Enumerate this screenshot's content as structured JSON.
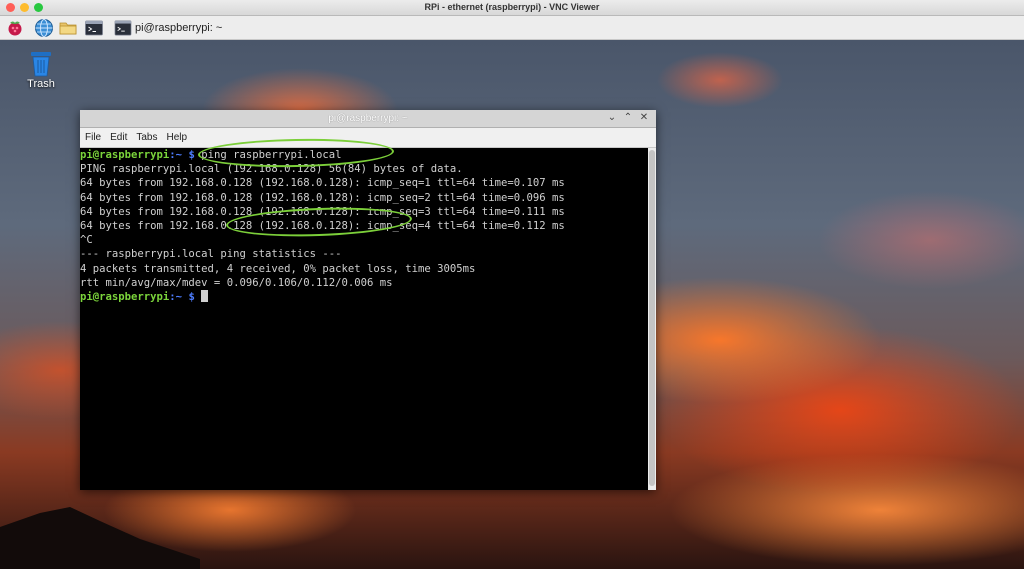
{
  "mac_window": {
    "title": "RPi - ethernet (raspberrypi) - VNC Viewer"
  },
  "taskbar": {
    "icons": [
      "raspberry-pi-menu-icon",
      "globe-browser-icon",
      "folder-icon",
      "terminal-icon"
    ],
    "task_label": "pi@raspberrypi: ~"
  },
  "desktop": {
    "trash_label": "Trash"
  },
  "terminal": {
    "title": "pi@raspberrypi: ~",
    "controls": {
      "minimize": "⌄",
      "maximize": "⌃",
      "close": "✕"
    },
    "menu": [
      "File",
      "Edit",
      "Tabs",
      "Help"
    ],
    "prompt_user": "pi@raspberrypi",
    "prompt_dir": ":~ ",
    "prompt_symbol": "$",
    "command": " ping raspberrypi.local",
    "output": [
      "PING raspberrypi.local (192.168.0.128) 56(84) bytes of data.",
      "64 bytes from 192.168.0.128 (192.168.0.128): icmp_seq=1 ttl=64 time=0.107 ms",
      "64 bytes from 192.168.0.128 (192.168.0.128): icmp_seq=2 ttl=64 time=0.096 ms",
      "64 bytes from 192.168.0.128 (192.168.0.128): icmp_seq=3 ttl=64 time=0.111 ms",
      "64 bytes from 192.168.0.128 (192.168.0.128): icmp_seq=4 ttl=64 time=0.112 ms",
      "^C",
      "--- raspberrypi.local ping statistics ---",
      "4 packets transmitted, 4 received, 0% packet loss, time 3005ms",
      "rtt min/avg/max/mdev = 0.096/0.106/0.112/0.006 ms"
    ]
  },
  "colors": {
    "prompt_user": "#7bd43b",
    "prompt_dir": "#4d7dff",
    "annotation": "#7ccf3a"
  }
}
